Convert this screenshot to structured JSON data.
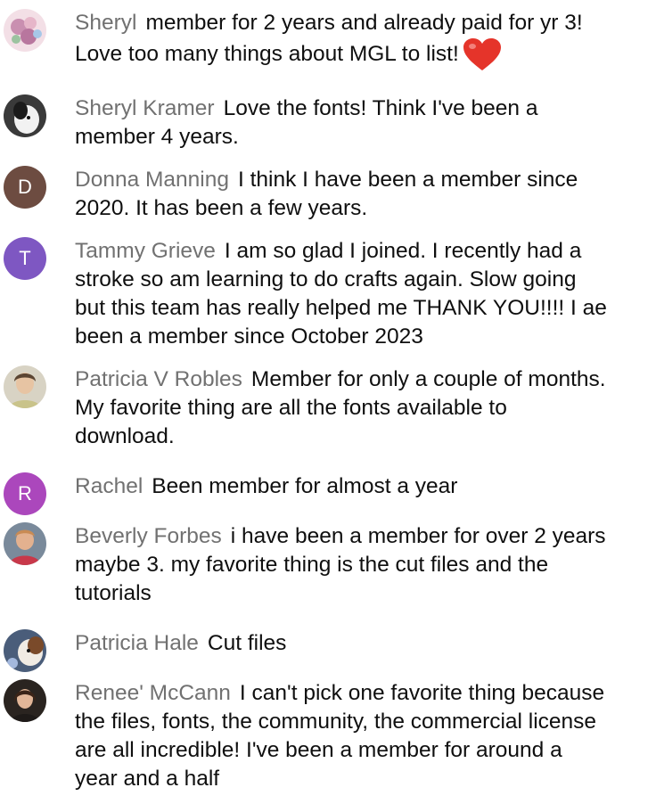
{
  "colors": {
    "author": "#717171",
    "message": "#0f0f0f",
    "heart": "#e5342a"
  },
  "comments": [
    {
      "author": "Sheryl",
      "text": "member for 2 years and already paid for yr 3! Love too many things about MGL to list!",
      "emoji": "heart-icon",
      "avatar": {
        "type": "image",
        "icon": "flower-avatar"
      }
    },
    {
      "author": "Sheryl Kramer",
      "text": "Love the fonts! Think I've been a member 4 years.",
      "avatar": {
        "type": "image",
        "icon": "dog-avatar"
      }
    },
    {
      "author": "Donna Manning",
      "text": "I think I have been a member since 2020. It has been a few years.",
      "avatar": {
        "type": "letter",
        "letter": "D",
        "color": "#6d4c41"
      }
    },
    {
      "author": "Tammy Grieve",
      "text": "I am so glad I joined. I recently had a stroke so am learning to do crafts again. Slow going but this team has really helped me THANK YOU!!!! I ae been a member since October 2023",
      "avatar": {
        "type": "letter",
        "letter": "T",
        "color": "#7e57c2"
      }
    },
    {
      "author": "Patricia V Robles",
      "text": "Member for only a couple of months. My favorite thing are all the fonts available to download.",
      "avatar": {
        "type": "image",
        "icon": "person-avatar"
      }
    },
    {
      "author": "Rachel",
      "text": "Been member for almost a year",
      "avatar": {
        "type": "letter",
        "letter": "R",
        "color": "#ab47bc"
      }
    },
    {
      "author": "Beverly Forbes",
      "text": "i have been a member for over 2 years maybe 3. my favorite thing is the cut files and the tutorials",
      "avatar": {
        "type": "image",
        "icon": "person-avatar"
      }
    },
    {
      "author": "Patricia Hale",
      "text": "Cut files",
      "avatar": {
        "type": "image",
        "icon": "dog-avatar"
      }
    },
    {
      "author": "Renee' McCann",
      "text": "I can't pick one favorite thing because the files, fonts, the community, the commercial license are all incredible! I've been a member for around a year and a half",
      "avatar": {
        "type": "image",
        "icon": "person-avatar"
      }
    }
  ]
}
